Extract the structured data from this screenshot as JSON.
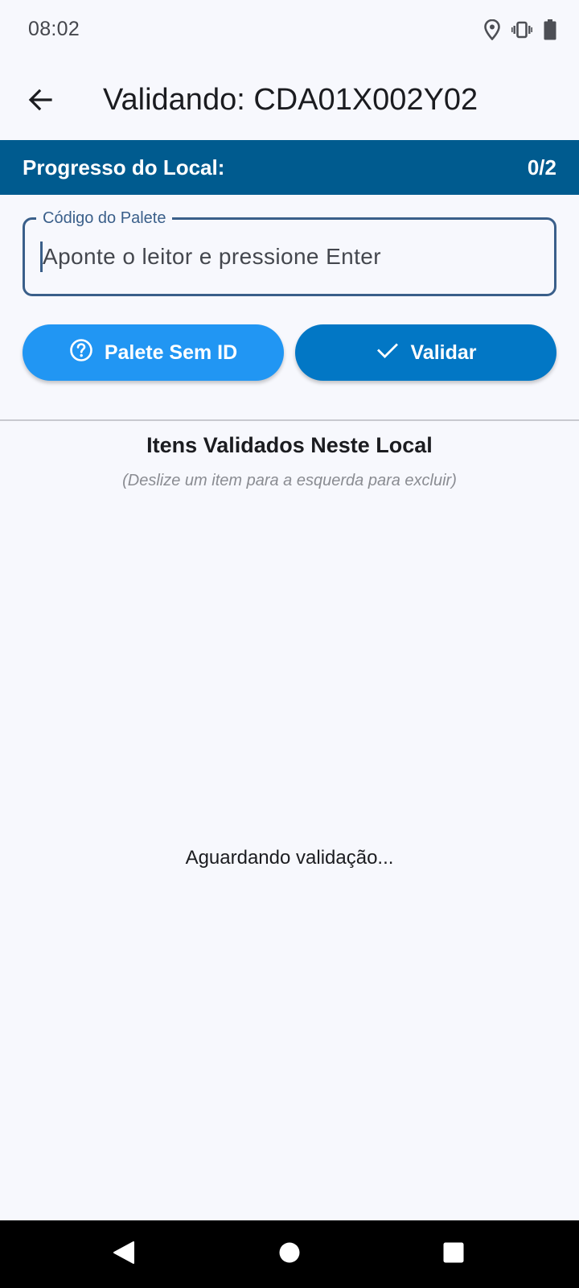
{
  "status_bar": {
    "time": "08:02",
    "icons": [
      "location-icon",
      "vibrate-icon",
      "battery-icon"
    ]
  },
  "app_bar": {
    "back_icon": "arrow-left-icon",
    "title": "Validando: CDA01X002Y02"
  },
  "progress": {
    "label": "Progresso do Local:",
    "value": "0/2",
    "color": "#005b8f"
  },
  "pallet_field": {
    "label": "Código do Palete",
    "placeholder": "Aponte o leitor e pressione Enter",
    "value": ""
  },
  "buttons": {
    "no_id": {
      "label": "Palete Sem ID",
      "icon": "help-circle-icon",
      "color": "#2196f3"
    },
    "validate": {
      "label": "Validar",
      "icon": "check-icon",
      "color": "#0277c5"
    }
  },
  "validated_section": {
    "title": "Itens Validados Neste Local",
    "hint": "(Deslize um item para a esquerda para excluir)",
    "empty_text": "Aguardando validação...",
    "items": []
  },
  "nav_bar": {
    "icons": [
      "back-triangle-icon",
      "home-circle-icon",
      "recents-square-icon"
    ]
  }
}
